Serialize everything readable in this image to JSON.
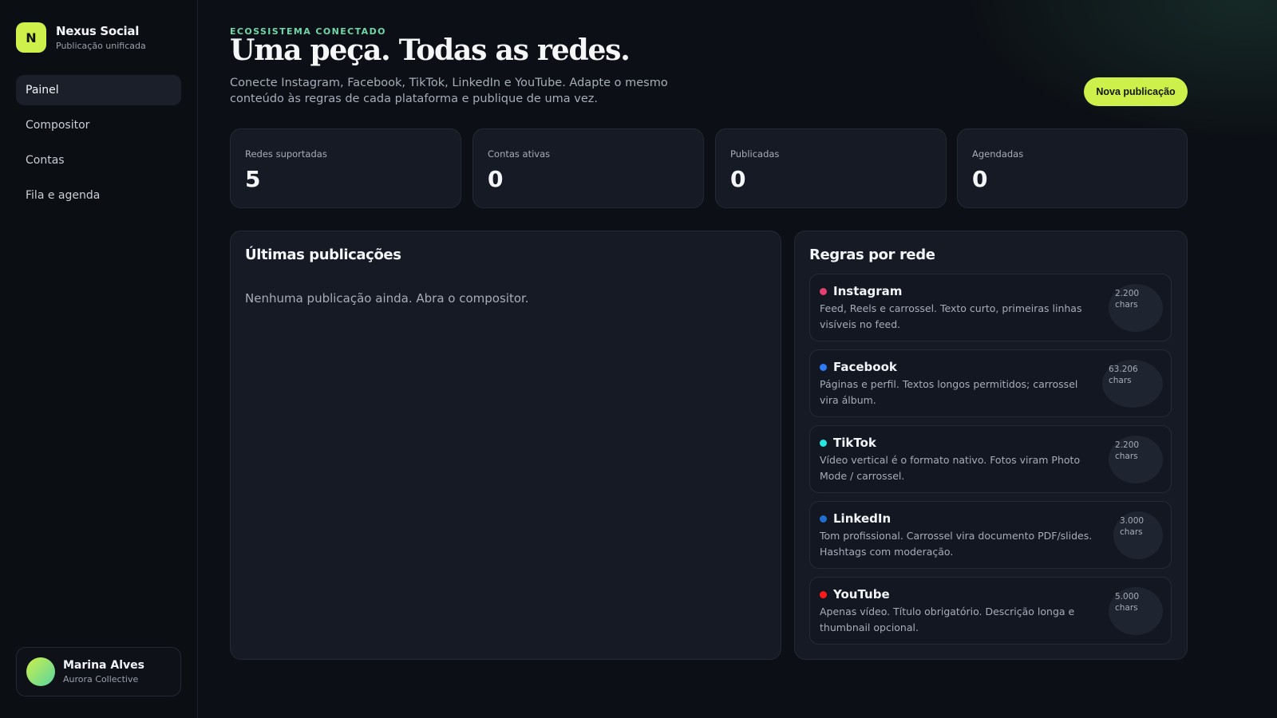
{
  "app": {
    "logo_letter": "N",
    "name": "Nexus Social",
    "subtitle": "Publicação unificada"
  },
  "sidebar": {
    "items": [
      {
        "label": "Painel",
        "active": true
      },
      {
        "label": "Compositor",
        "active": false
      },
      {
        "label": "Contas",
        "active": false
      },
      {
        "label": "Fila e agenda",
        "active": false
      }
    ]
  },
  "user": {
    "name": "Marina Alves",
    "org": "Aurora Collective"
  },
  "hero": {
    "eyebrow": "ECOSSISTEMA CONECTADO",
    "title": "Uma peça. Todas as redes.",
    "description": "Conecte Instagram, Facebook, TikTok, LinkedIn e YouTube. Adapte o mesmo conteúdo às regras de cada plataforma e publique de uma vez.",
    "cta_label": "Nova publicação"
  },
  "stats": [
    {
      "label": "Redes suportadas",
      "value": "5"
    },
    {
      "label": "Contas ativas",
      "value": "0"
    },
    {
      "label": "Publicadas",
      "value": "0"
    },
    {
      "label": "Agendadas",
      "value": "0"
    }
  ],
  "recent": {
    "title": "Últimas publicações",
    "empty_message": "Nenhuma publicação ainda. Abra o compositor."
  },
  "rules": {
    "title": "Regras por rede",
    "networks": [
      {
        "name": "Instagram",
        "color": "#e4406f",
        "description": "Feed, Reels e carrossel. Texto curto, primeiras linhas visíveis no feed.",
        "limit": "2.200",
        "unit": "chars"
      },
      {
        "name": "Facebook",
        "color": "#2e7bf6",
        "description": "Páginas e perfil. Textos longos permitidos; carrossel vira álbum.",
        "limit": "63.206",
        "unit": "chars"
      },
      {
        "name": "TikTok",
        "color": "#25e6e0",
        "description": "Vídeo vertical é o formato nativo. Fotos viram Photo Mode / carrossel.",
        "limit": "2.200",
        "unit": "chars"
      },
      {
        "name": "LinkedIn",
        "color": "#1f6fd1",
        "description": "Tom profissional. Carrossel vira documento PDF/slides. Hashtags com moderação.",
        "limit": "3.000",
        "unit": "chars"
      },
      {
        "name": "YouTube",
        "color": "#ff1a1a",
        "description": "Apenas vídeo. Título obrigatório. Descrição longa e thumbnail opcional.",
        "limit": "5.000",
        "unit": "chars"
      }
    ]
  },
  "colors": {
    "accent": "#cdf04a",
    "eyebrow": "#6fd8a8"
  }
}
